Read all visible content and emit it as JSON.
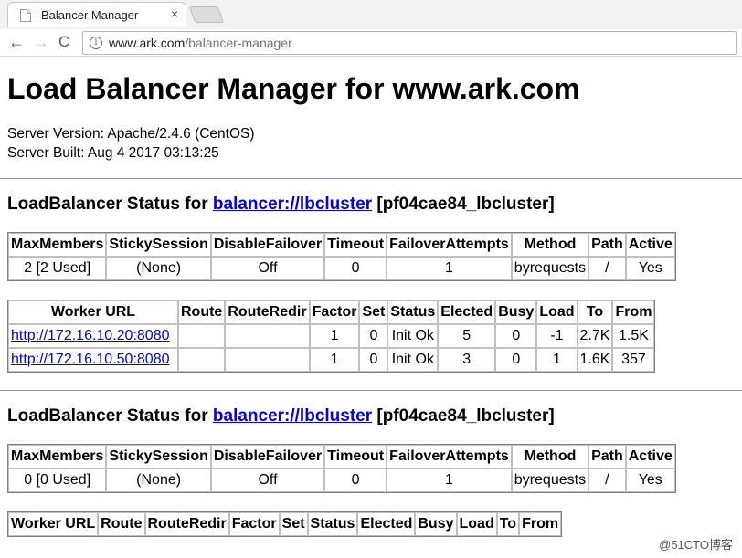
{
  "browser": {
    "tab_title": "Balancer Manager",
    "tab_close": "×",
    "url_host": "www.ark.com",
    "url_path": "/balancer-manager",
    "back_glyph": "←",
    "forward_glyph": "→",
    "reload_glyph": "C",
    "info_glyph": "i"
  },
  "page": {
    "title": "Load Balancer Manager for www.ark.com",
    "server_version": "Server Version: Apache/2.4.6 (CentOS)",
    "server_built": "Server Built: Aug 4 2017 03:13:25"
  },
  "balancers": [
    {
      "heading_prefix": "LoadBalancer Status for ",
      "link": "balancer://lbcluster",
      "suffix": " [pf04cae84_lbcluster]",
      "settings_headers": [
        "MaxMembers",
        "StickySession",
        "DisableFailover",
        "Timeout",
        "FailoverAttempts",
        "Method",
        "Path",
        "Active"
      ],
      "settings_row": [
        "2 [2 Used]",
        "(None)",
        "Off",
        "0",
        "1",
        "byrequests",
        "/",
        "Yes"
      ],
      "worker_headers": [
        "Worker URL",
        "Route",
        "RouteRedir",
        "Factor",
        "Set",
        "Status",
        "Elected",
        "Busy",
        "Load",
        "To",
        "From"
      ],
      "workers": [
        [
          "http://172.16.10.20:8080",
          "",
          "",
          "1",
          "0",
          "Init Ok",
          "5",
          "0",
          "-1",
          "2.7K",
          "1.5K"
        ],
        [
          "http://172.16.10.50:8080",
          "",
          "",
          "1",
          "0",
          "Init Ok",
          "3",
          "0",
          "1",
          "1.6K",
          "357"
        ]
      ]
    },
    {
      "heading_prefix": "LoadBalancer Status for ",
      "link": "balancer://lbcluster",
      "suffix": " [pf04cae84_lbcluster]",
      "settings_headers": [
        "MaxMembers",
        "StickySession",
        "DisableFailover",
        "Timeout",
        "FailoverAttempts",
        "Method",
        "Path",
        "Active"
      ],
      "settings_row": [
        "0 [0 Used]",
        "(None)",
        "Off",
        "0",
        "1",
        "byrequests",
        "/",
        "Yes"
      ],
      "worker_headers": [
        "Worker URL",
        "Route",
        "RouteRedir",
        "Factor",
        "Set",
        "Status",
        "Elected",
        "Busy",
        "Load",
        "To",
        "From"
      ],
      "workers": []
    }
  ],
  "watermark": "@51CTO博客"
}
